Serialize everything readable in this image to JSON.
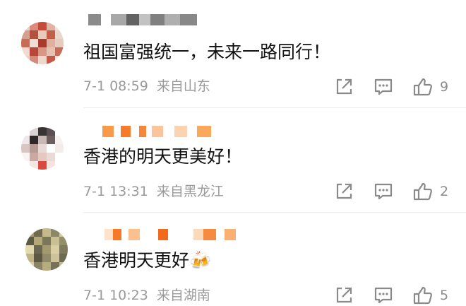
{
  "comments": [
    {
      "username": "",
      "text": "祖国富强统一，未来一路同行！",
      "time": "7-1 08:59",
      "source": "来自山东",
      "likes": "9",
      "avatar_colors": [
        "#e8d2c8",
        "#d98a7c",
        "#c44a3a",
        "#e2b2a2",
        "#f3e1d8",
        "#d4a08f",
        "#b5523f",
        "#e9c9bb",
        "#c0604b",
        "#ead7cc",
        "#c96a57",
        "#f1ddd2",
        "#a83b2c",
        "#dfb09f",
        "#e6cbbf",
        "#f0dbd0",
        "#b8473a",
        "#d99684",
        "#e4c2b4",
        "#c76c5b",
        "#ecd4c8",
        "#d48b79",
        "#edd8cc",
        "#c25a49",
        "#f2e2da"
      ]
    },
    {
      "username": "",
      "text": "香港的明天更美好！",
      "time": "7-1 13:31",
      "source": "来自黑龙江",
      "likes": "2",
      "avatar_colors": [
        "#ffffff",
        "#d9d2d4",
        "#3a3334",
        "#5a4f52",
        "#ffffff",
        "#efe8ea",
        "#2e2829",
        "#c9b8b6",
        "#6d5f60",
        "#f7f1f2",
        "#d8c6c2",
        "#b59b94",
        "#e9d9d5",
        "#ffffff",
        "#f4ecea",
        "#f9f4f3",
        "#caa9a2",
        "#e6c8c1",
        "#ead9d5",
        "#ffffff",
        "#ffffff",
        "#f3e6e3",
        "#d84a3e",
        "#f6e2de",
        "#ffffff"
      ]
    },
    {
      "username": "",
      "text": "香港明天更好🍻",
      "time": "7-1 10:23",
      "source": "来自湖南",
      "likes": "5",
      "avatar_colors": [
        "#a39a6f",
        "#6f6a4e",
        "#c4b98b",
        "#8c8766",
        "#d3cba0",
        "#5d5a43",
        "#b3a978",
        "#7b7657",
        "#c8bf93",
        "#948e6b",
        "#e2d9ae",
        "#6b6650",
        "#a49a70",
        "#d9cfa5",
        "#7f7a5c",
        "#bfb586",
        "#5c5841",
        "#918b69",
        "#cdc39a",
        "#6e6a51",
        "#d8cfa6",
        "#8b8565",
        "#b6ac7e",
        "#76715a",
        "#c3b98d"
      ]
    }
  ],
  "colors": {
    "meta_gray": "#9a9a9a",
    "icon_gray": "#8a8a8a",
    "username_orange": "#f79a4a"
  },
  "icons": [
    "share-icon",
    "comment-icon",
    "like-icon"
  ]
}
